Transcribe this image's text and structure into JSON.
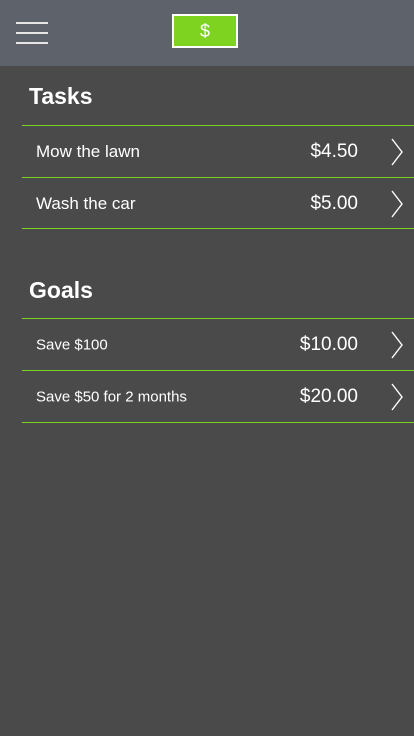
{
  "header": {
    "menu_icon": "hamburger-menu-icon",
    "money_button_label": "$",
    "accent_color": "#7ed321"
  },
  "tasks": {
    "title": "Tasks",
    "items": [
      {
        "label": "Mow the lawn",
        "amount": "$4.50"
      },
      {
        "label": "Wash the car",
        "amount": "$5.00"
      }
    ]
  },
  "goals": {
    "title": "Goals",
    "items": [
      {
        "label": "Save $100",
        "amount": "$10.00"
      },
      {
        "label": "Save $50 for 2 months",
        "amount": "$20.00"
      }
    ]
  }
}
